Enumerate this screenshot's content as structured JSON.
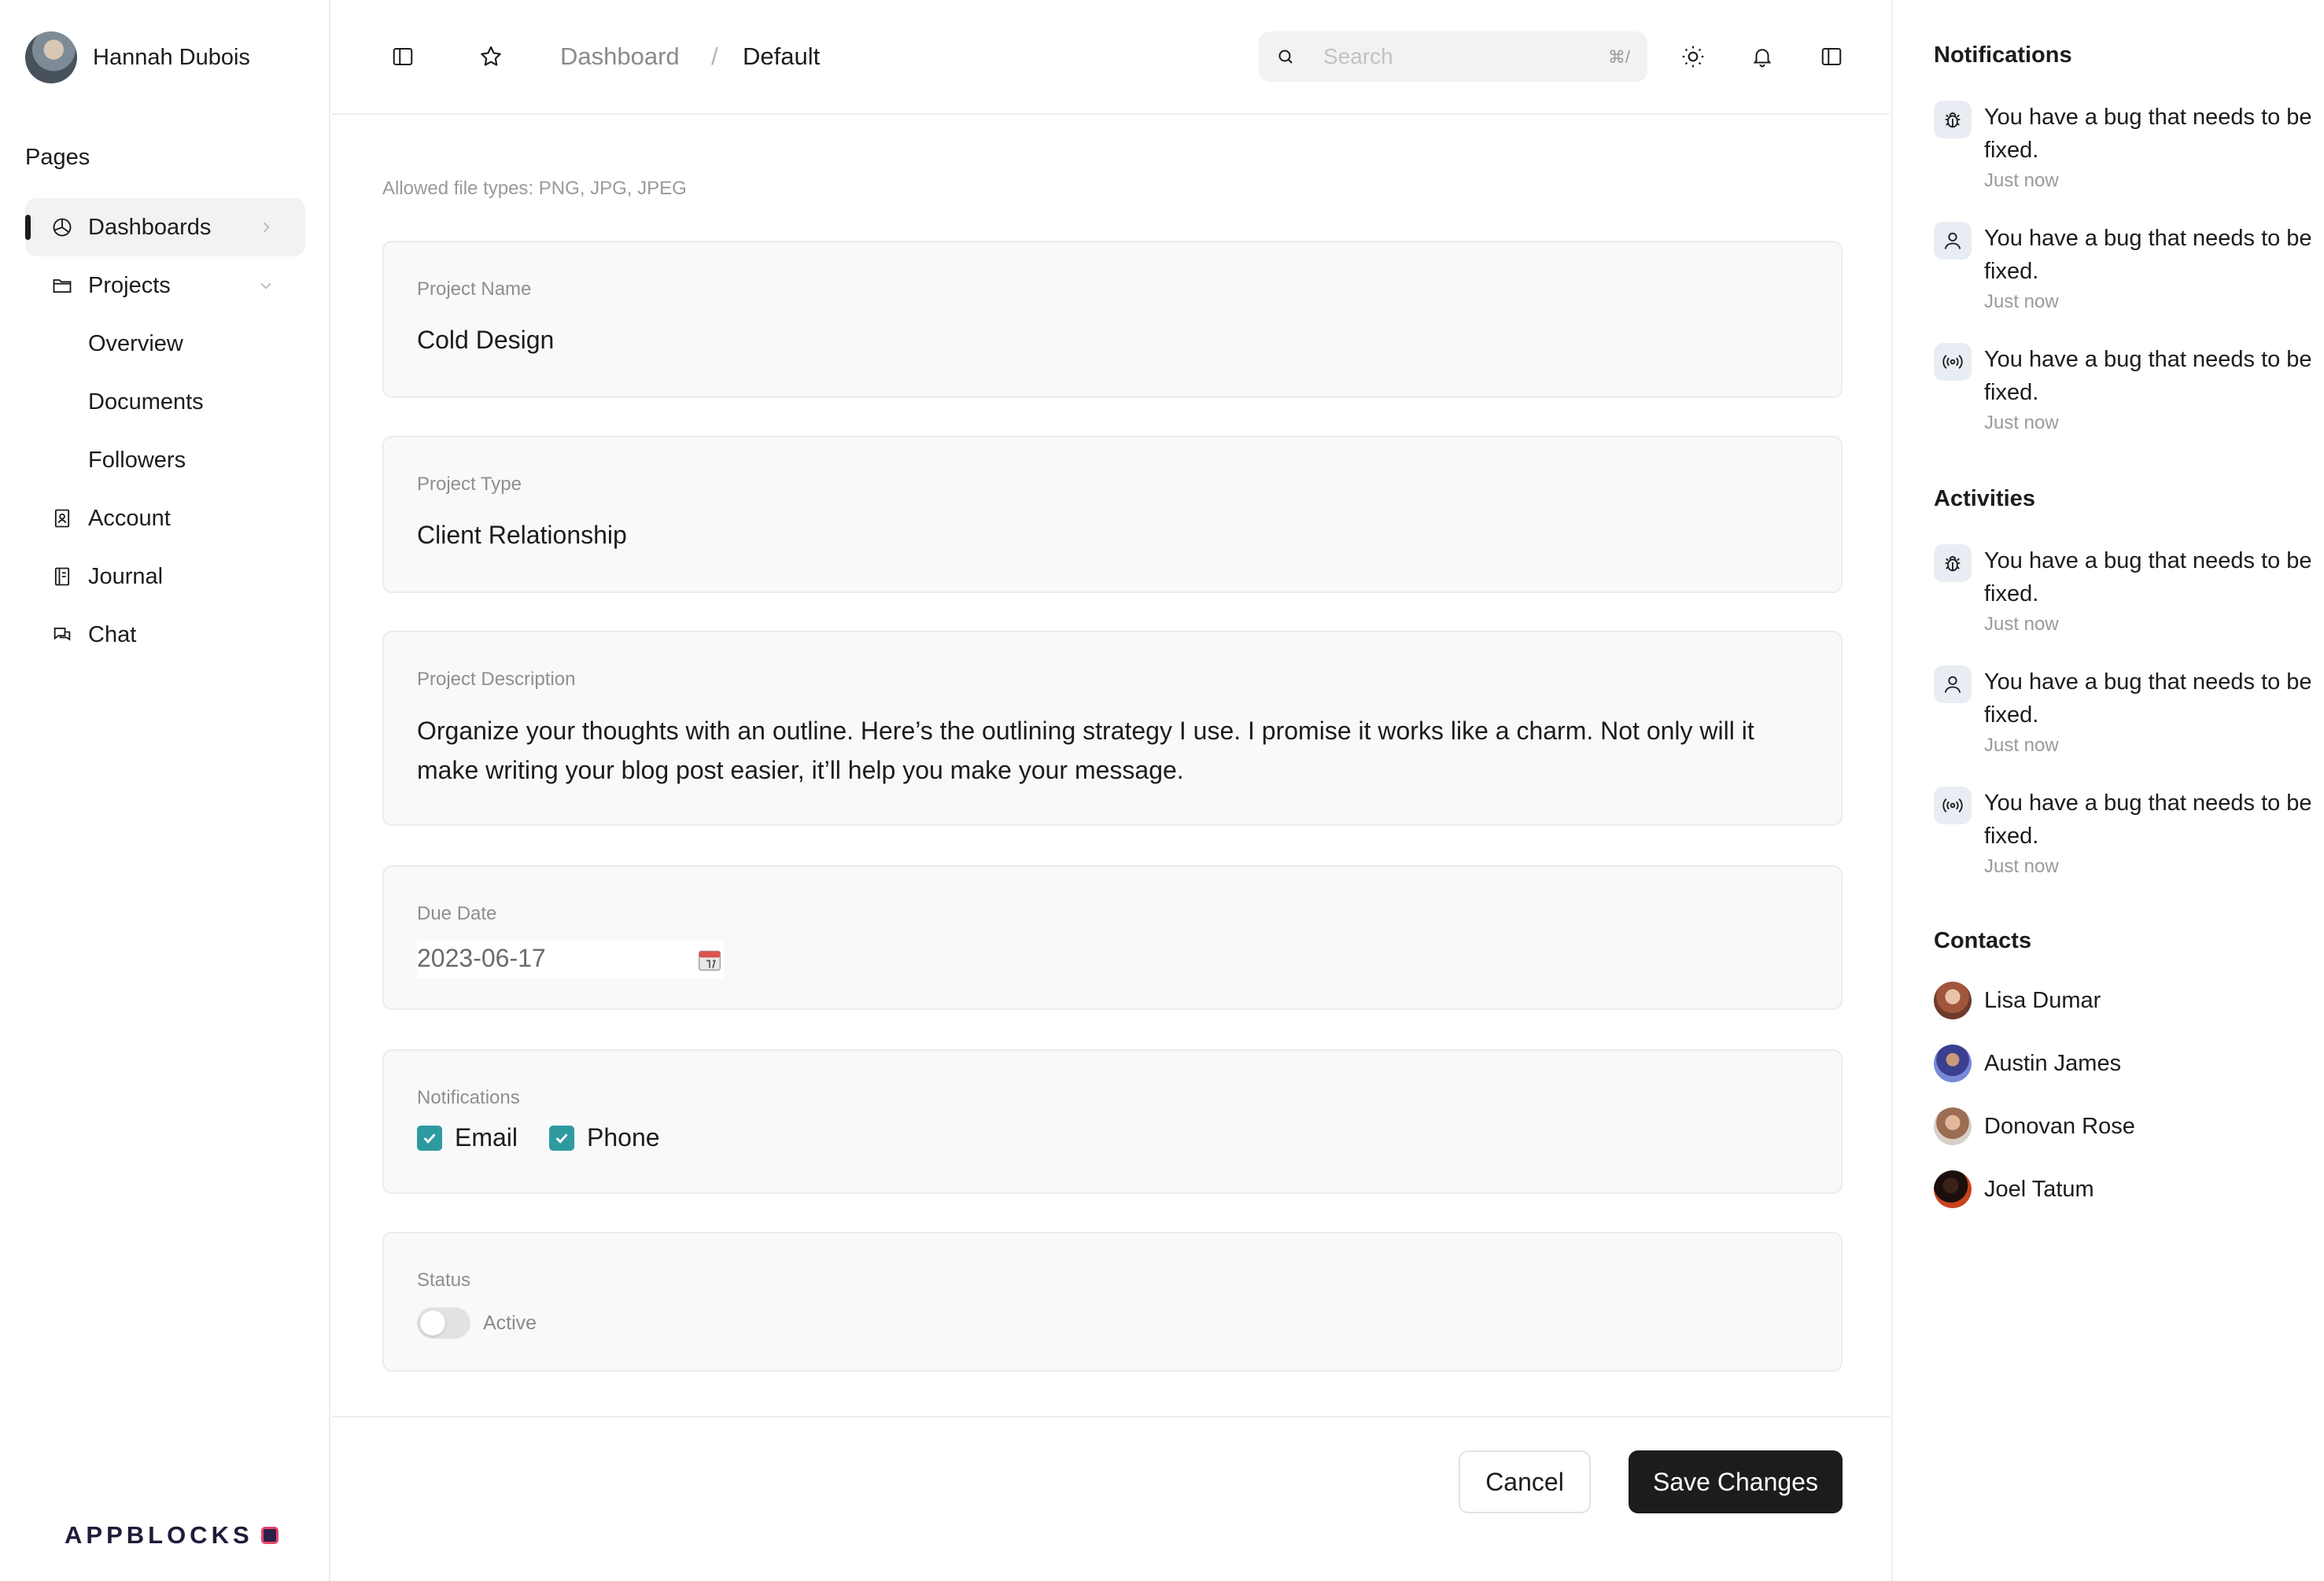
{
  "user": {
    "name": "Hannah Dubois"
  },
  "sidebar": {
    "section_label": "Pages",
    "items": [
      {
        "label": "Dashboards",
        "icon": "pie-chart-icon",
        "active": true
      },
      {
        "label": "Projects",
        "icon": "folder-icon"
      },
      {
        "label": "Overview"
      },
      {
        "label": "Documents"
      },
      {
        "label": "Followers"
      },
      {
        "label": "Account",
        "icon": "contact-card-icon"
      },
      {
        "label": "Journal",
        "icon": "notebook-icon"
      },
      {
        "label": "Chat",
        "icon": "chat-icon"
      }
    ],
    "brand": "APPBLOCKS"
  },
  "header": {
    "breadcrumb": {
      "parent": "Dashboard",
      "separator": "/",
      "current": "Default"
    },
    "search": {
      "placeholder": "Search",
      "shortcut": "⌘/"
    }
  },
  "form": {
    "allowed_types": "Allowed file types: PNG, JPG, JPEG",
    "project_name": {
      "label": "Project Name",
      "value": "Cold Design"
    },
    "project_type": {
      "label": "Project Type",
      "value": "Client Relationship"
    },
    "project_description": {
      "label": "Project Description",
      "value": "Organize your thoughts with an outline. Here’s the outlining strategy I use. I promise it works like a charm. Not only will it make writing your blog post easier, it’ll help you make your message."
    },
    "due_date": {
      "label": "Due Date",
      "value": "2023-06-17"
    },
    "notifications": {
      "label": "Notifications",
      "options": [
        {
          "label": "Email",
          "checked": true
        },
        {
          "label": "Phone",
          "checked": true
        }
      ]
    },
    "status": {
      "label": "Status",
      "toggle_label": "Active",
      "on": false
    },
    "cancel_label": "Cancel",
    "save_label": "Save Changes"
  },
  "right_panel": {
    "notifications_title": "Notifications",
    "notifications": [
      {
        "icon": "bug-icon",
        "text": "You have a bug that needs to be fixed.",
        "time": "Just now"
      },
      {
        "icon": "user-icon",
        "text": "You have a bug that needs to be fixed.",
        "time": "Just now"
      },
      {
        "icon": "broadcast-icon",
        "text": "You have a bug that needs to be fixed.",
        "time": "Just now"
      }
    ],
    "activities_title": "Activities",
    "activities": [
      {
        "icon": "bug-icon",
        "text": "You have a bug that needs to be fixed.",
        "time": "Just now"
      },
      {
        "icon": "user-icon",
        "text": "You have a bug that needs to be fixed.",
        "time": "Just now"
      },
      {
        "icon": "broadcast-icon",
        "text": "You have a bug that needs to be fixed.",
        "time": "Just now"
      }
    ],
    "contacts_title": "Contacts",
    "contacts": [
      {
        "name": "Lisa Dumar"
      },
      {
        "name": "Austin James"
      },
      {
        "name": "Donovan Rose"
      },
      {
        "name": "Joel Tatum"
      }
    ]
  },
  "colors": {
    "accent": "#2e9aa0",
    "primary_button": "#1c1c1c",
    "card_bg": "#f8f9fa"
  }
}
